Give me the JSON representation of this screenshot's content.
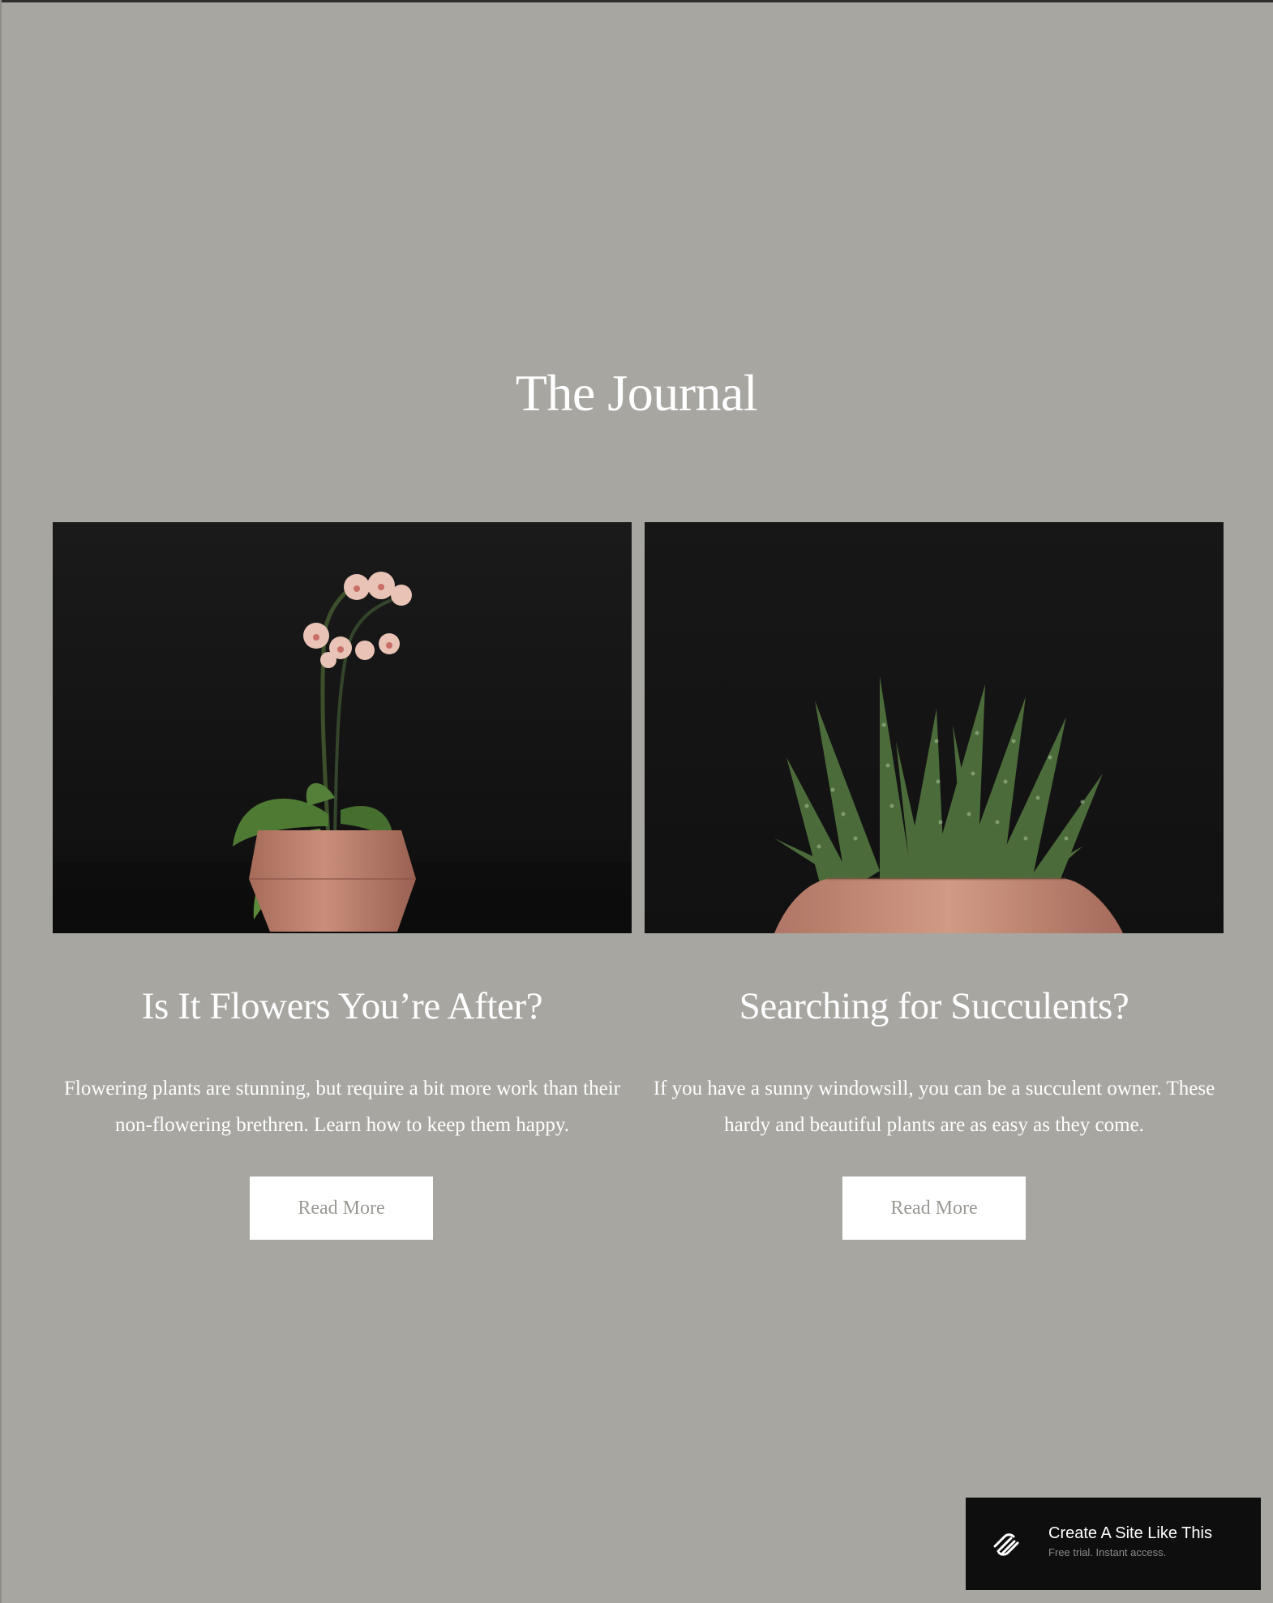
{
  "page": {
    "title": "The Journal"
  },
  "cards": [
    {
      "image_alt": "Orchid in terracotta pot",
      "title": "Is It Flowers You’re After?",
      "description": "Flowering plants are stunning, but require a bit more work than their non-flowering brethren. Learn how to keep them happy.",
      "button_label": "Read More"
    },
    {
      "image_alt": "Succulent in terracotta pot",
      "title": "Searching for Succulents?",
      "description": "If you have a sunny windowsill, you can be a succulent owner. These hardy and beautiful plants are as easy as they come.",
      "button_label": "Read More"
    }
  ],
  "promo": {
    "title": "Create A Site Like This",
    "subtitle": "Free trial. Instant access.",
    "icon": "squarespace-logo-icon"
  },
  "colors": {
    "background": "#a7a6a1",
    "photo_background": "#141414",
    "button_background": "#ffffff",
    "button_text": "#9a9994",
    "promo_background": "#0e0e0e",
    "pot": "#c58a78",
    "leaf": "#4f7a34"
  }
}
